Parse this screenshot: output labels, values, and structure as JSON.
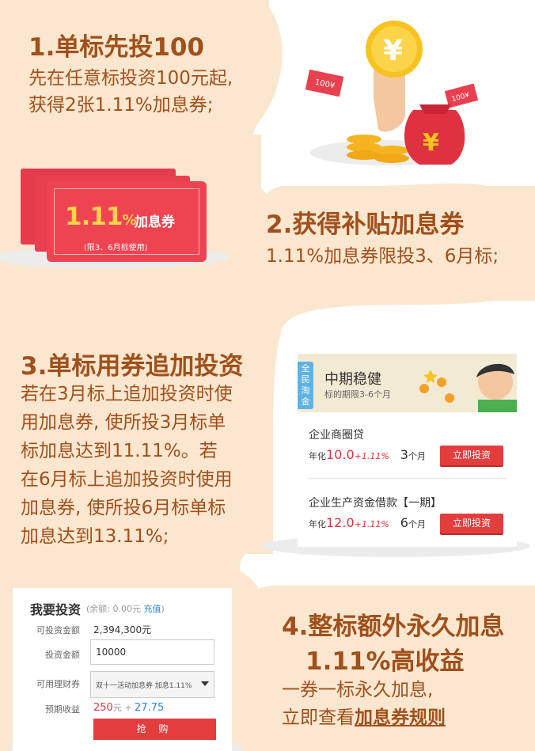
{
  "step1": {
    "title": "1.单标先投100",
    "line1": "先在任意标投资100元起,",
    "line2": "获得2张1.11%加息券;",
    "note_left": "100¥",
    "note_right": "100¥",
    "coin_symbol": "¥",
    "bag_symbol": "¥"
  },
  "coupon": {
    "rate": "1.11",
    "pct": "%",
    "label": "加息券",
    "note": "(限3、6月标使用)"
  },
  "step2": {
    "title": "2.获得补贴加息券",
    "line1": "1.11%加息券限投3、6月标;"
  },
  "step3": {
    "title": "3.单标用券追加投资",
    "lines": [
      "若在3月标上追加投资时使",
      "用加息券, 使所投3月标单",
      "标加息达到11.11%。若",
      "在6月标上追加投资时使用",
      "加息券, 使所投6月标单标",
      "加息达到13.11%;"
    ]
  },
  "product_card": {
    "badge": "全民淘金",
    "title": "中期稳健",
    "subtitle": "标的期限3-6个月",
    "products": [
      {
        "name": "企业商圈贷",
        "rate_label": "年化",
        "rate": "10.0",
        "bonus": "+1.11%",
        "months": "3",
        "month_unit": "个月",
        "button": "立即投资"
      },
      {
        "name": "企业生产资金借款【一期】",
        "rate_label": "年化",
        "rate": "12.0",
        "bonus": "+1.11%",
        "months": "6",
        "month_unit": "个月",
        "button": "立即投资"
      }
    ]
  },
  "invest_panel": {
    "title": "我要投资",
    "balance_prefix": "(余额: 0.00元 ",
    "recharge": "充值",
    "balance_suffix": ")",
    "available_label": "可投资金额",
    "available_value": "2,394,300元",
    "amount_label": "投资金额",
    "amount_value": "10000",
    "coupon_label": "可用理财券",
    "coupon_value": "双十一活动加息券 加息1.11%",
    "earn_label": "预期收益",
    "earn_a": "250",
    "earn_a_unit": "元",
    "earn_plus": " + ",
    "earn_b": "27.75",
    "button": "抢 购"
  },
  "step4": {
    "title": "4.整标额外永久加息",
    "subtitle": "1.11%高收益",
    "line1": "一券一标永久加息,",
    "line2_prefix": "立即查看",
    "rule_link": "加息券规则"
  },
  "colors": {
    "brown": "#a0501b",
    "cream": "#fbe6cf",
    "red": "#e43d3d",
    "coupon_red": "#ee4452",
    "gold": "#f8c221"
  }
}
